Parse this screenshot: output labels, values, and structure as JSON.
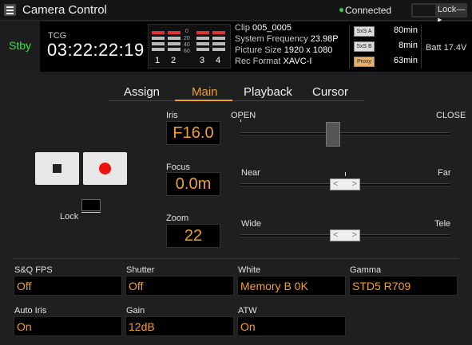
{
  "app": {
    "title": "Camera Control"
  },
  "header": {
    "status": "Connected",
    "lock_label": "Lock—▸"
  },
  "status": {
    "mode": "Stby",
    "tcg_label": "TCG",
    "timecode": "03:22:22:19",
    "meter_scale": [
      "0",
      "20",
      "40",
      "60"
    ],
    "channels": [
      "1",
      "2",
      "3",
      "4"
    ],
    "clip_label": "Clip",
    "clip": "005_0005",
    "sysfreq_label": "System Frequency",
    "sysfreq": "23.98P",
    "picsize_label": "Picture Size",
    "picsize": "1920 x 1080",
    "recfmt_label": "Rec Format",
    "recfmt": "XAVC-I",
    "media": [
      {
        "icon": "SxS A",
        "value": "80min"
      },
      {
        "icon": "SxS B",
        "value": "8min"
      },
      {
        "icon": "Proxy",
        "value": "63min"
      }
    ],
    "batt_label": "Batt",
    "batt": "17.4V"
  },
  "tabs": [
    {
      "label": "Assign",
      "active": false
    },
    {
      "label": "Main",
      "active": true
    },
    {
      "label": "Playback",
      "active": false
    },
    {
      "label": "Cursor",
      "active": false
    }
  ],
  "controls": {
    "lock_label": "Lock",
    "iris": {
      "label": "Iris",
      "value": "F16.0",
      "min_label": "OPEN",
      "max_label": "CLOSE",
      "position": 0.43
    },
    "focus": {
      "label": "Focus",
      "value": "0.0m",
      "min_label": "Near",
      "max_label": "Far",
      "position": 0.5
    },
    "zoom": {
      "label": "Zoom",
      "value": "22",
      "min_label": "Wide",
      "max_label": "Tele",
      "position": 0.5
    }
  },
  "fields": [
    {
      "label": "S&Q FPS",
      "value": "Off"
    },
    {
      "label": "Shutter",
      "value": "Off"
    },
    {
      "label": "White",
      "value": "Memory B 0K"
    },
    {
      "label": "Gamma",
      "value": "STD5 R709"
    },
    {
      "label": "Auto Iris",
      "value": "On"
    },
    {
      "label": "Gain",
      "value": "12dB"
    },
    {
      "label": "ATW",
      "value": "On"
    }
  ],
  "colors": {
    "accent": "#f0a030",
    "standby": "#38e13f",
    "connected": "#2fd04a",
    "record": "#e11111"
  }
}
